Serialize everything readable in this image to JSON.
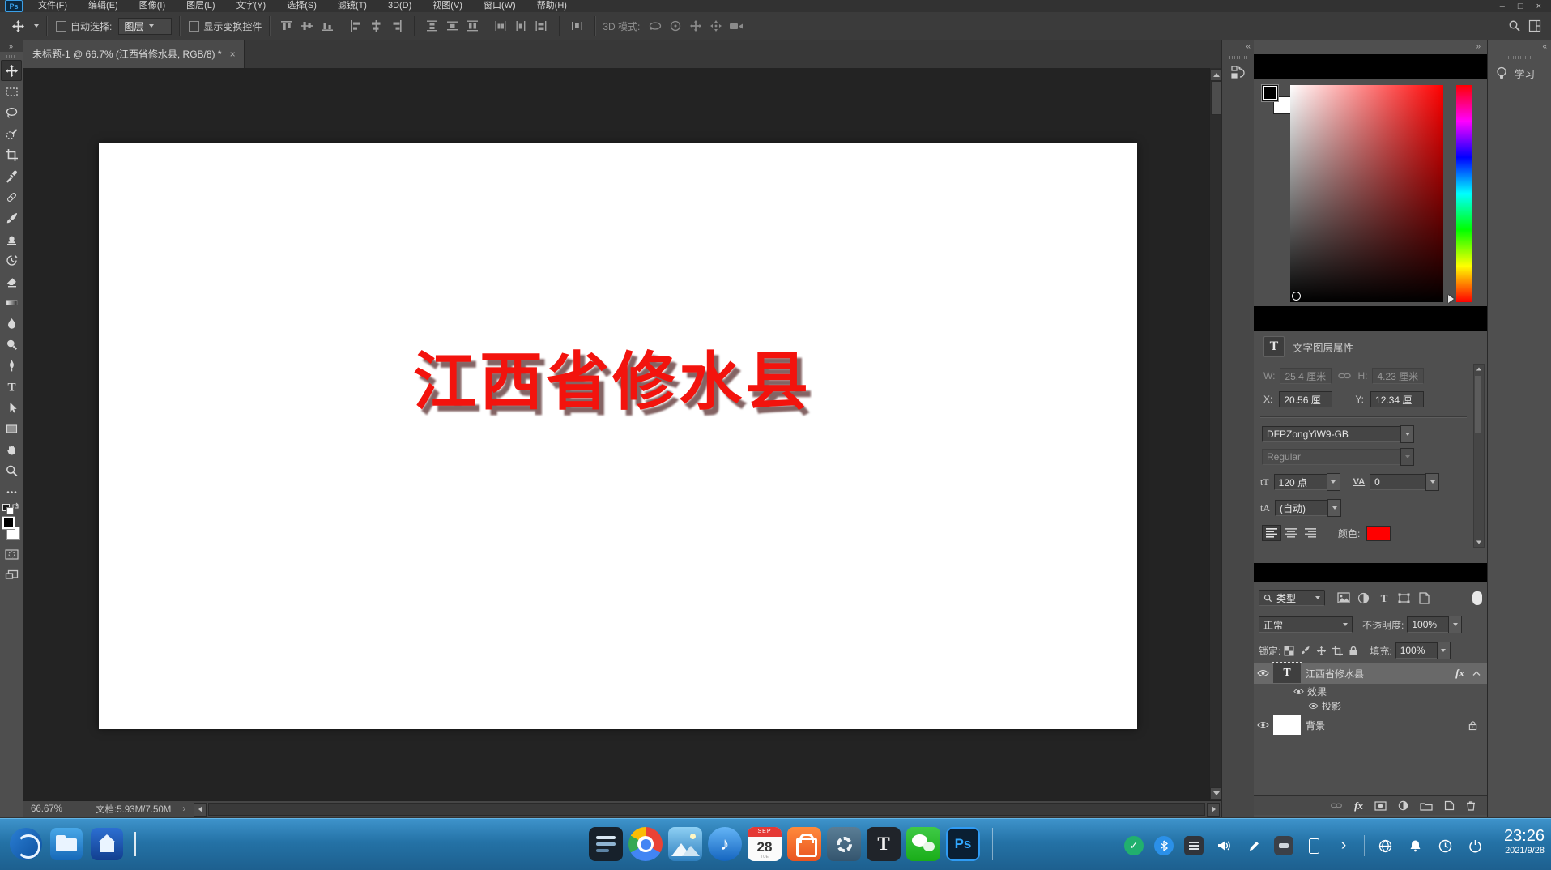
{
  "menu_bar": {
    "logo": "Ps",
    "items": [
      "文件(F)",
      "编辑(E)",
      "图像(I)",
      "图层(L)",
      "文字(Y)",
      "选择(S)",
      "滤镜(T)",
      "3D(D)",
      "视图(V)",
      "窗口(W)",
      "帮助(H)"
    ],
    "minimize": "–",
    "maximize": "□",
    "close": "×"
  },
  "options_bar": {
    "auto_select_label": "自动选择:",
    "auto_select_value": "图层",
    "show_transform_label": "显示变换控件",
    "threed_mode_label": "3D 模式:"
  },
  "document_tab": {
    "title": "未标题-1 @ 66.7% (江西省修水县, RGB/8) *",
    "close": "×"
  },
  "toolbar": {
    "expand": "»"
  },
  "docks": {
    "collapse_left": "«",
    "collapse_right": "»"
  },
  "canvas": {
    "text": "江西省修水县"
  },
  "learn_panel": {
    "label": "学习"
  },
  "color_panel": {
    "selected_hue": "#ff0000",
    "foreground": "#000000",
    "background": "#ffffff"
  },
  "type_properties_panel": {
    "title": "文字图层属性",
    "w_label": "W:",
    "w_value": "25.4 厘米",
    "h_label": "H:",
    "h_value": "4.23 厘米",
    "x_label": "X:",
    "x_value": "20.56 厘",
    "y_label": "Y:",
    "y_value": "12.34 厘",
    "font_family": "DFPZongYiW9-GB",
    "font_style": "Regular",
    "size_icon": "tT",
    "size_value": "120 点",
    "tracking_icon": "VA",
    "tracking_value": "0",
    "leading_icon": "tA",
    "leading_value": "(自动)",
    "color_label": "颜色:",
    "text_color": "#ff0000"
  },
  "layers_panel": {
    "filter_value": "类型",
    "blend_mode": "正常",
    "opacity_label": "不透明度:",
    "opacity_value": "100%",
    "lock_label": "锁定:",
    "fill_label": "填充:",
    "fill_value": "100%",
    "text_layer_name": "江西省修水县",
    "fx_badge": "fx",
    "effects_label": "效果",
    "drop_shadow_label": "投影",
    "background_label": "背景",
    "fx_button": "fx"
  },
  "status_bar": {
    "zoom": "66.67%",
    "doc_info": "文档:5.93M/7.50M",
    "expand": "›"
  },
  "taskbar": {
    "calendar_month": "SEP",
    "calendar_day": "28",
    "text_editor_label": "T",
    "photoshop_label": "Ps",
    "time": "23:26",
    "date": "2021/9/28"
  }
}
